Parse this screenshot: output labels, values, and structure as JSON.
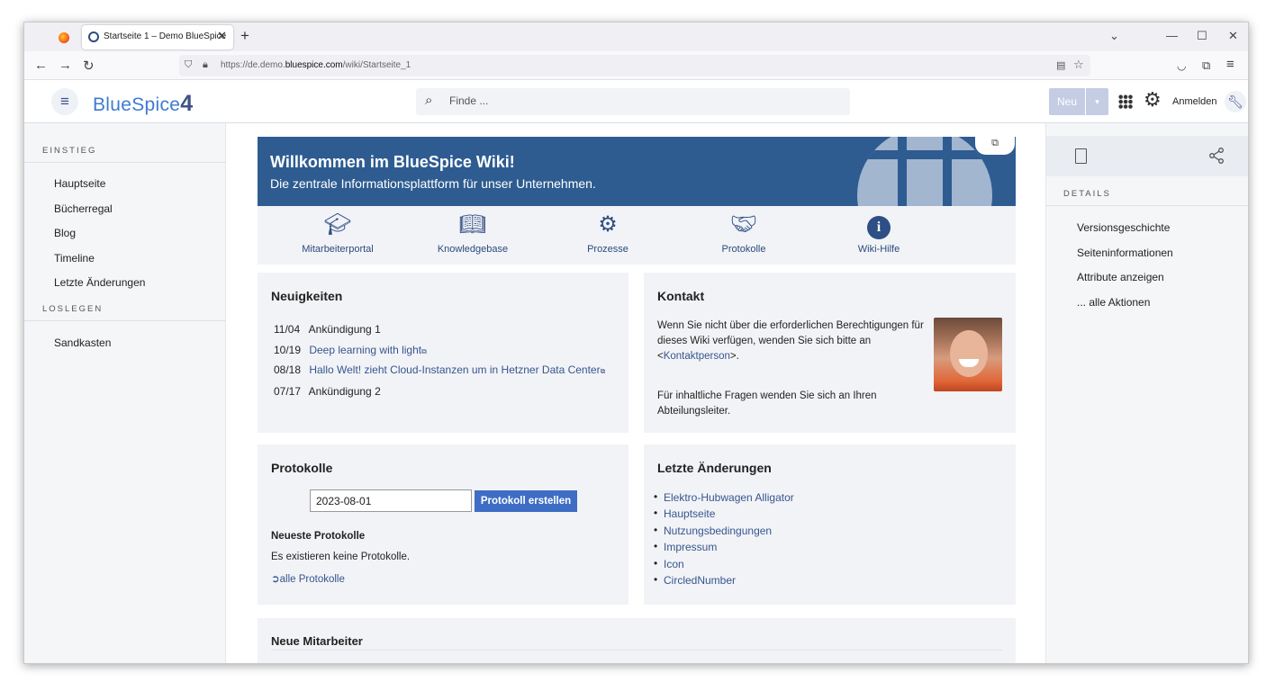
{
  "browser": {
    "tab_title": "Startseite 1 – Demo BlueSpice",
    "url_prefix": "https://de.demo.",
    "url_domain": "bluespice.com",
    "url_path": "/wiki/Startseite_1"
  },
  "header": {
    "logo_text": "BlueSpice",
    "logo_number": "4",
    "search_placeholder": "Finde ...",
    "new_button": "Neu",
    "login": "Anmelden"
  },
  "left_sidebar": {
    "section1": "EINSTIEG",
    "items1": [
      "Hauptseite",
      "Bücherregal",
      "Blog",
      "Timeline",
      "Letzte Änderungen"
    ],
    "section2": "LOSLEGEN",
    "items2": [
      "Sandkasten"
    ]
  },
  "right_sidebar": {
    "section": "DETAILS",
    "items": [
      "Versionsgeschichte",
      "Seiteninformationen",
      "Attribute anzeigen",
      "... alle Aktionen"
    ]
  },
  "hero": {
    "title": "Willkommen im BlueSpice Wiki!",
    "subtitle": "Die zentrale Informationsplattform für unser Unternehmen."
  },
  "portal": [
    {
      "label": "Mitarbeiterportal",
      "icon": "graduation-icon"
    },
    {
      "label": "Knowledgebase",
      "icon": "reader-icon"
    },
    {
      "label": "Prozesse",
      "icon": "gears-icon"
    },
    {
      "label": "Protokolle",
      "icon": "handshake-icon"
    },
    {
      "label": "Wiki-Hilfe",
      "icon": "info-icon"
    }
  ],
  "news": {
    "title": "Neuigkeiten",
    "items": [
      {
        "date": "11/04",
        "text": "Ankündigung 1",
        "link": false
      },
      {
        "date": "10/19",
        "text": "Deep learning with light",
        "link": true
      },
      {
        "date": "08/18",
        "text": "Hallo Welt! zieht Cloud-Instanzen um in Hetzner Data Center",
        "link": true
      },
      {
        "date": "07/17",
        "text": "Ankündigung 2",
        "link": false
      }
    ]
  },
  "contact": {
    "title": "Kontakt",
    "line1": "Wenn Sie nicht über die erforderlichen Berechtigungen für",
    "line2": "dieses Wiki verfügen, wenden Sie sich bitte an",
    "line3_pre": "<",
    "line3_link": "Kontaktperson",
    "line3_post": ">.",
    "line4": "Für inhaltliche Fragen wenden Sie sich an Ihren",
    "line5": "Abteilungsleiter."
  },
  "protocols": {
    "title": "Protokolle",
    "date_value": "2023-08-01",
    "create_button": "Protokoll erstellen",
    "newest_label": "Neueste Protokolle",
    "none_text": "Es existieren keine Protokolle.",
    "all_link": "alle Protokolle"
  },
  "recent": {
    "title": "Letzte Änderungen",
    "items": [
      "Elektro-Hubwagen Alligator",
      "Hauptseite",
      "Nutzungsbedingungen",
      "Impressum",
      "Icon",
      "CircledNumber"
    ]
  },
  "new_staff": {
    "title": "Neue Mitarbeiter"
  },
  "colors": {
    "hero_bg": "#2e5c91",
    "accent": "#3e6dc5",
    "link": "#36558f"
  }
}
